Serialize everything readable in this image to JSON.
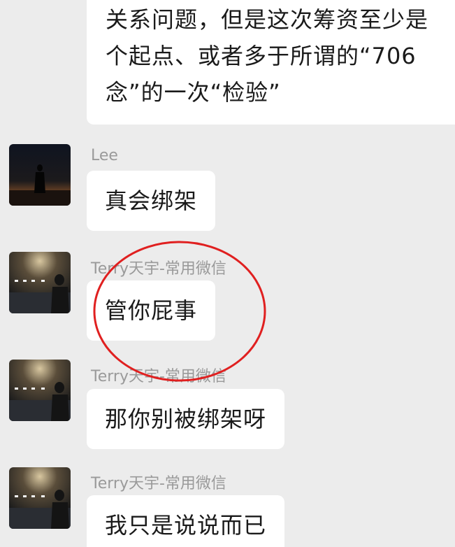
{
  "messages": [
    {
      "text": "关系问题，但是这次筹资至少是\n个起点、或者多于所谓的“706\n念”的一次“检验”"
    },
    {
      "sender": "Lee",
      "avatar_icon": "silhouette-sunset-avatar",
      "text": "真会绑架"
    },
    {
      "sender": "Terry天宇-常用微信",
      "avatar_icon": "room-lights-avatar",
      "text": "管你屁事"
    },
    {
      "sender": "Terry天宇-常用微信",
      "avatar_icon": "room-lights-avatar",
      "text": "那你别被绑架呀"
    },
    {
      "sender": "Terry天宇-常用微信",
      "avatar_icon": "room-lights-avatar",
      "text": "我只是说说而已"
    }
  ],
  "annotation": {
    "shape": "circle-highlight",
    "color": "#e02020"
  },
  "colors": {
    "background": "#ececec",
    "bubble": "#ffffff",
    "sender_name": "#9a9a9a"
  }
}
